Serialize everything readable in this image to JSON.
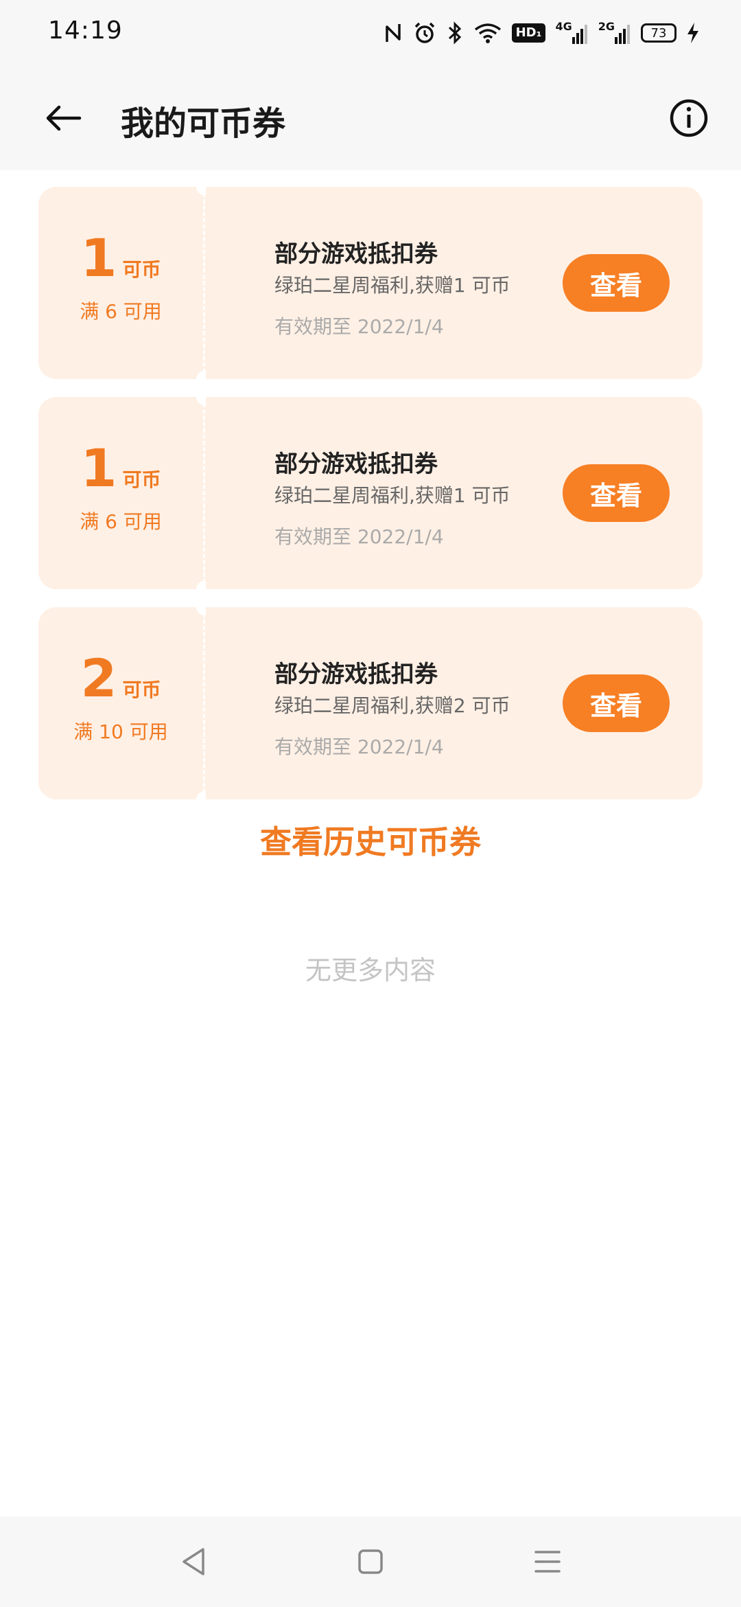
{
  "status_bar": {
    "time": "14:19",
    "icons": [
      "nfc-icon",
      "alarm-icon",
      "bluetooth-icon",
      "wifi-icon",
      "hd-icon",
      "signal-4g-icon",
      "signal-2g-icon",
      "battery-icon",
      "charging-icon"
    ],
    "hd_label": "HD₁",
    "sig1_label": "4G",
    "sig2_label": "2G",
    "battery_level": "73"
  },
  "header": {
    "title": "我的可币券",
    "back_icon": "back-arrow-icon",
    "info_icon": "info-icon"
  },
  "coupons": [
    {
      "amount": "1",
      "unit": "可币",
      "condition": "满 6 可用",
      "title": "部分游戏抵扣券",
      "description": "绿珀二星周福利,获赠1 可币",
      "expiry": "有效期至 2022/1/4",
      "button": "查看"
    },
    {
      "amount": "1",
      "unit": "可币",
      "condition": "满 6 可用",
      "title": "部分游戏抵扣券",
      "description": "绿珀二星周福利,获赠1 可币",
      "expiry": "有效期至 2022/1/4",
      "button": "查看"
    },
    {
      "amount": "2",
      "unit": "可币",
      "condition": "满 10 可用",
      "title": "部分游戏抵扣券",
      "description": "绿珀二星周福利,获赠2 可币",
      "expiry": "有效期至 2022/1/4",
      "button": "查看"
    }
  ],
  "history_link": "查看历史可币券",
  "no_more": "无更多内容",
  "nav_bar": {
    "buttons": [
      "back-triangle-icon",
      "home-square-icon",
      "menu-lines-icon"
    ]
  },
  "colors": {
    "accent": "#f77f24",
    "coupon_bg": "#fff0e5",
    "amount_text": "#f07a22"
  }
}
